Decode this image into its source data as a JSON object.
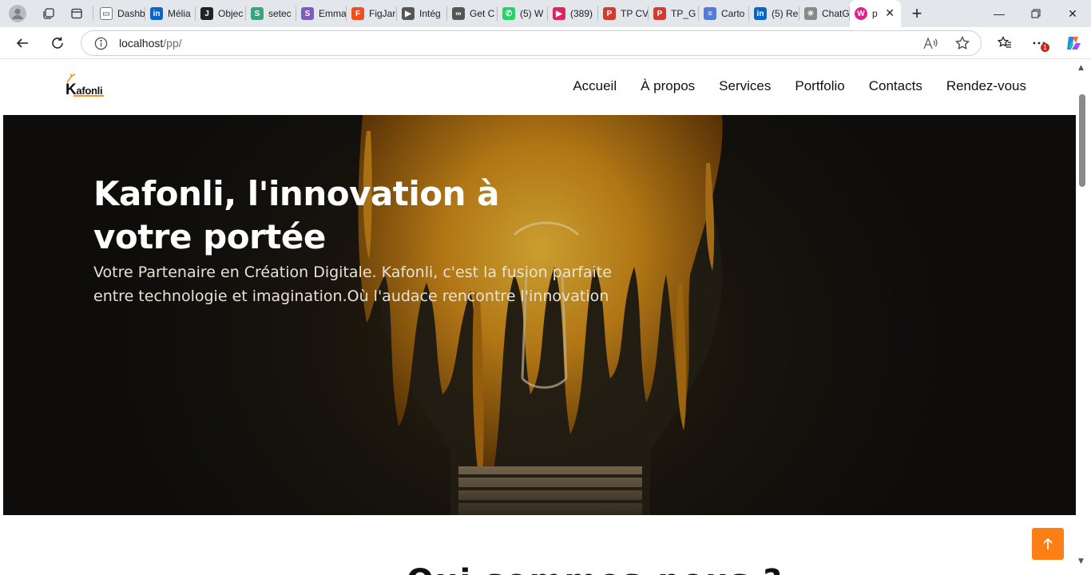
{
  "browser": {
    "tabs": [
      {
        "title": "Dashb",
        "icon": "page-icon",
        "color": "#ffffff"
      },
      {
        "title": "Mélia",
        "icon": "linkedin-icon",
        "color": "#0a66c2"
      },
      {
        "title": "Objec",
        "icon": "j-icon",
        "color": "#222222"
      },
      {
        "title": "setec",
        "icon": "swirl-icon",
        "color": "#3aa57a"
      },
      {
        "title": "Emma",
        "icon": "s-icon",
        "color": "#7c5cbf"
      },
      {
        "title": "FigJar",
        "icon": "figma-icon",
        "color": "#f24e1e"
      },
      {
        "title": "Intég",
        "icon": "video-icon",
        "color": "#555555"
      },
      {
        "title": "Get C",
        "icon": "link-icon",
        "color": "#555555"
      },
      {
        "title": "(5) W",
        "icon": "whatsapp-icon",
        "color": "#25d366"
      },
      {
        "title": "(389)",
        "icon": "youtube-icon",
        "color": "#e0245e"
      },
      {
        "title": "TP CV",
        "icon": "pdf-icon",
        "color": "#d23c2f"
      },
      {
        "title": "TP_G",
        "icon": "pdf-icon",
        "color": "#d23c2f"
      },
      {
        "title": "Carto",
        "icon": "forms-icon",
        "color": "#4f7bd9"
      },
      {
        "title": "(5) Re",
        "icon": "linkedin-icon",
        "color": "#0a66c2"
      },
      {
        "title": "ChatG",
        "icon": "openai-icon",
        "color": "#888888"
      }
    ],
    "active_tab": {
      "title": "p",
      "icon": "site-icon",
      "color": "#e0218a"
    },
    "url_host": "localhost",
    "url_path": "/pp/",
    "notification_count": "1"
  },
  "site": {
    "logo_initial": "K",
    "logo_rest": "afonli",
    "nav": [
      "Accueil",
      "À propos",
      "Services",
      "Portfolio",
      "Contacts",
      "Rendez-vous"
    ],
    "hero_title_line1": "Kafonli, l'innovation à",
    "hero_title_line2": "votre portée",
    "hero_text_line1": "Votre Partenaire en Création Digitale. Kafonli, c'est la fusion parfaite",
    "hero_text_line2": "entre technologie et imagination.Où l'audace rencontre l'innovation",
    "accent_color": "#fd7e14"
  }
}
